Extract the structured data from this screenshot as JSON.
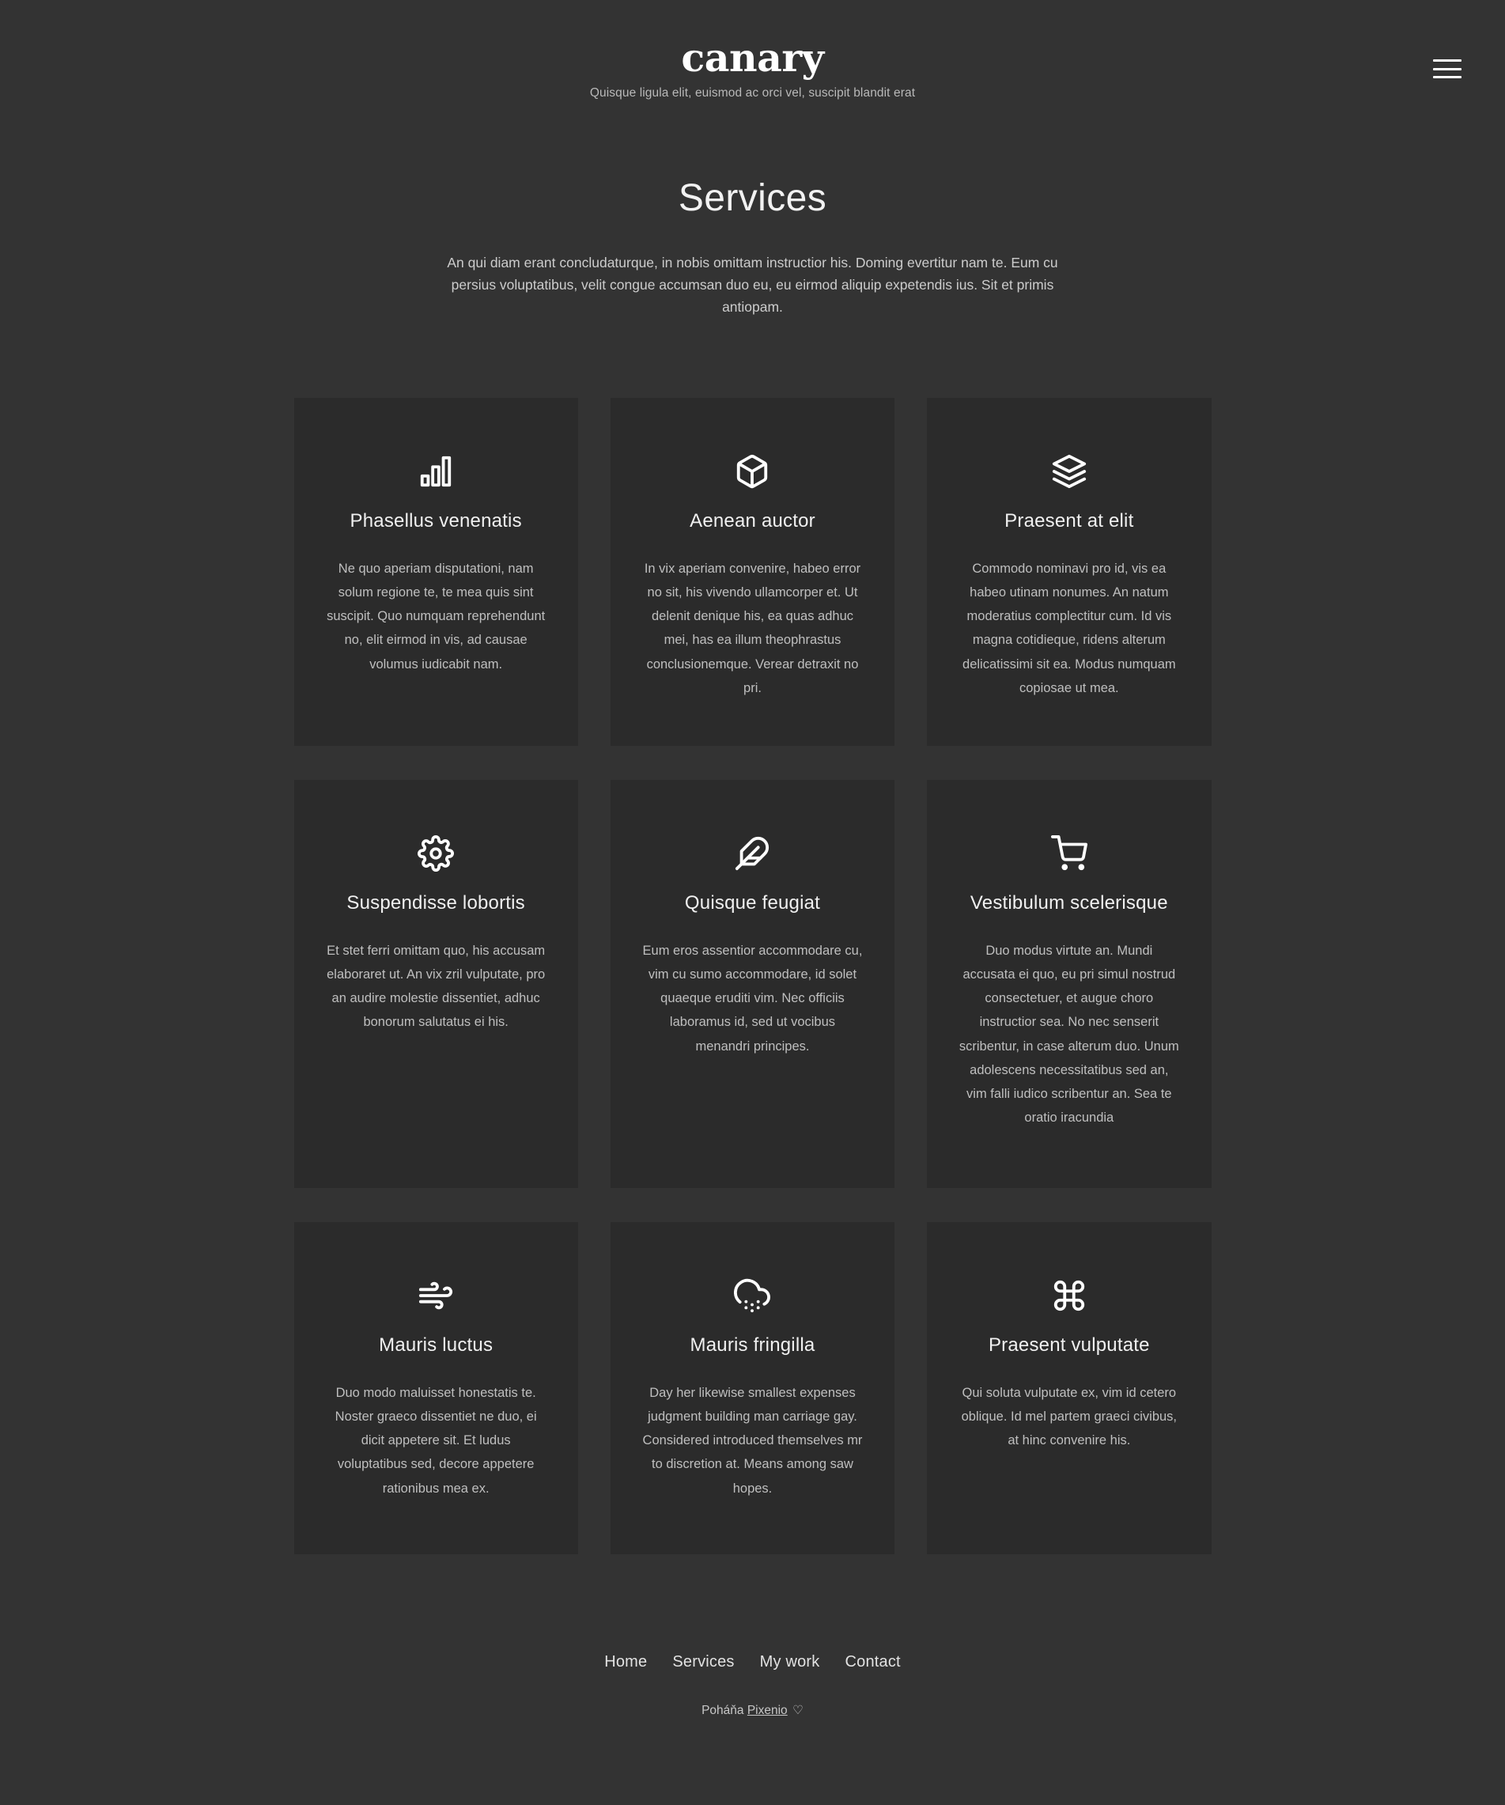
{
  "theme": {
    "page_bg": "#333333",
    "card_bg": "#2b2b2b",
    "text_primary": "#f0f0f0",
    "text_secondary": "#bfbfbf",
    "accent": "#ffffff"
  },
  "header": {
    "logo": "canary",
    "tagline": "Quisque ligula elit, euismod ac orci vel, suscipit blandit erat",
    "menu_icon": "hamburger-menu-icon"
  },
  "intro": {
    "title": "Services",
    "subtitle": "An qui diam erant concludaturque, in nobis omittam instructior his. Doming evertitur nam te. Eum cu persius voluptatibus, velit congue accumsan duo eu, eu eirmod aliquip expetendis ius. Sit et primis antiopam."
  },
  "cards": [
    {
      "icon": "bar-chart-icon",
      "title": "Phasellus venenatis",
      "text": "Ne quo aperiam disputationi, nam solum regione te, te mea quis sint suscipit. Quo numquam reprehendunt no, elit eirmod in vis, ad causae volumus iudicabit nam."
    },
    {
      "icon": "box-icon",
      "title": "Aenean auctor",
      "text": "In vix aperiam convenire, habeo error no sit, his vivendo ullamcorper et. Ut delenit denique his, ea quas adhuc mei, has ea illum theophrastus conclusionemque. Verear detraxit no pri."
    },
    {
      "icon": "layers-icon",
      "title": "Praesent at elit",
      "text": "Commodo nominavi pro id, vis ea habeo utinam nonumes. An natum moderatius complectitur cum. Id vis magna cotidieque, ridens alterum delicatissimi sit ea. Modus numquam copiosae ut mea."
    },
    {
      "icon": "gear-icon",
      "title": "Suspendisse lobortis",
      "text": "Et stet ferri omittam quo, his accusam elaboraret ut. An vix zril vulputate, pro an audire molestie dissentiet, adhuc bonorum salutatus ei his."
    },
    {
      "icon": "feather-icon",
      "title": "Quisque feugiat",
      "text": "Eum eros assentior accommodare cu, vim cu sumo accommodare, id solet quaeque eruditi vim. Nec officiis laboramus id, sed ut vocibus menandri principes."
    },
    {
      "icon": "shopping-cart-icon",
      "title": "Vestibulum scelerisque",
      "text": "Duo modus virtute an. Mundi accusata ei quo, eu pri simul nostrud consectetuer, et augue choro instructior sea. No nec senserit scribentur, in case alterum duo. Unum adolescens necessitatibus sed an, vim falli iudico scribentur an. Sea te oratio iracundia"
    },
    {
      "icon": "wind-icon",
      "title": "Mauris luctus",
      "text": "Duo modo maluisset honestatis te. Noster graeco dissentiet ne duo, ei dicit appetere sit. Et ludus voluptatibus sed, decore appetere rationibus mea ex."
    },
    {
      "icon": "cloud-snow-icon",
      "title": "Mauris fringilla",
      "text": "Day her likewise smallest expenses judgment building man carriage gay. Considered introduced themselves mr to discretion at. Means among saw hopes."
    },
    {
      "icon": "command-icon",
      "title": "Praesent vulputate",
      "text": "Qui soluta vulputate ex, vim id cetero oblique. Id mel partem graeci civibus, at hinc convenire his."
    }
  ],
  "footer": {
    "nav": [
      {
        "label": "Home"
      },
      {
        "label": "Services"
      },
      {
        "label": "My work"
      },
      {
        "label": "Contact"
      }
    ],
    "credit_prefix": "Poháňa",
    "credit_link": "Pixenio",
    "credit_heart": "♡"
  }
}
